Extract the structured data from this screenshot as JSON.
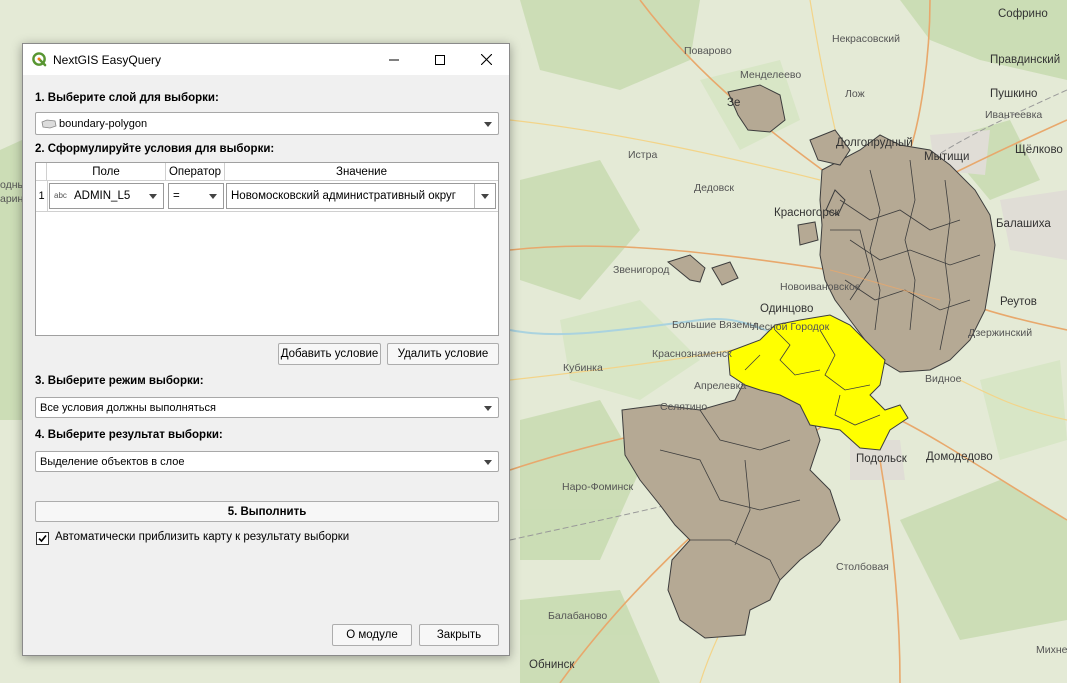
{
  "map": {
    "labels": [
      {
        "id": "sofrino",
        "text": "Софрино"
      },
      {
        "id": "nekrasovsky",
        "text": "Некрасовский"
      },
      {
        "id": "povarovo",
        "text": "Поварово"
      },
      {
        "id": "pravdinsky",
        "text": "Правдинский"
      },
      {
        "id": "mendeleevo",
        "text": "Менделеево"
      },
      {
        "id": "pushkino",
        "text": "Пушкино"
      },
      {
        "id": "zelenograd",
        "text": "Зе"
      },
      {
        "id": "lozhki",
        "text": "Лож"
      },
      {
        "id": "ivanteevka",
        "text": "Ивантеевка"
      },
      {
        "id": "dolgoprudny",
        "text": "Долгопрудный"
      },
      {
        "id": "mytishchi",
        "text": "Мытищи"
      },
      {
        "id": "shchelkovo",
        "text": "Щёлково"
      },
      {
        "id": "istra",
        "text": "Истра"
      },
      {
        "id": "dedovsk",
        "text": "Дедовск"
      },
      {
        "id": "krasnogorsk",
        "text": "Красногорск"
      },
      {
        "id": "balashikha",
        "text": "Балашиха"
      },
      {
        "id": "zvenigorod",
        "text": "Звенигород"
      },
      {
        "id": "novoivanovskoe",
        "text": "Новоивановское"
      },
      {
        "id": "odintsovo",
        "text": "Одинцово"
      },
      {
        "id": "reutov",
        "text": "Реутов"
      },
      {
        "id": "bolshie_vyazemy",
        "text": "Большие Вяземы"
      },
      {
        "id": "lesnoy_gorodok",
        "text": "Лесной Городок"
      },
      {
        "id": "dzerzhinsky",
        "text": "Дзержинский"
      },
      {
        "id": "krasnoznamensk",
        "text": "Краснознаменск"
      },
      {
        "id": "kubinka",
        "text": "Кубинка"
      },
      {
        "id": "vidnoe",
        "text": "Видное"
      },
      {
        "id": "aprelevka",
        "text": "Апрелевка"
      },
      {
        "id": "selyatino",
        "text": "Селятино"
      },
      {
        "id": "podolsk",
        "text": "Подольск"
      },
      {
        "id": "domodedovo",
        "text": "Домодедово"
      },
      {
        "id": "naro_fominsk",
        "text": "Наро-Фоминск"
      },
      {
        "id": "stolbovaya",
        "text": "Столбовая"
      },
      {
        "id": "balabanovo",
        "text": "Балабаново"
      },
      {
        "id": "obninsk",
        "text": "Обнинск"
      },
      {
        "id": "mikhnevo",
        "text": "Михнево"
      },
      {
        "id": "ozhnye",
        "text": "одные"
      },
      {
        "id": "arino",
        "text": "арино"
      }
    ]
  },
  "dialog": {
    "title": "NextGIS EasyQuery",
    "step1_label": "1. Выберите слой для выборки:",
    "layer_value": "boundary-polygon",
    "step2_label": "2. Сформулируйте условия для выборки:",
    "table": {
      "headers": {
        "field": "Поле",
        "operator": "Оператор",
        "value": "Значение"
      },
      "rows": [
        {
          "num": "1",
          "field_type": "abc",
          "field": "ADMIN_L5",
          "operator": "=",
          "value": "Новомосковский административный округ"
        }
      ]
    },
    "add_condition": "Добавить условие",
    "delete_condition": "Удалить условие",
    "step3_label": "3. Выберите режим выборки:",
    "mode_value": "Все условия должны выполняться",
    "step4_label": "4. Выберите результат выборки:",
    "result_value": "Выделение объектов в слое",
    "execute": "5. Выполнить",
    "autozoom_label": "Автоматически приблизить карту к результату выборки",
    "autozoom_checked": true,
    "about": "О модуле",
    "close": "Закрыть"
  },
  "colors": {
    "polygon_fill": "#b5a994",
    "selected_fill": "#ffff00",
    "accent_green": "#589632"
  }
}
